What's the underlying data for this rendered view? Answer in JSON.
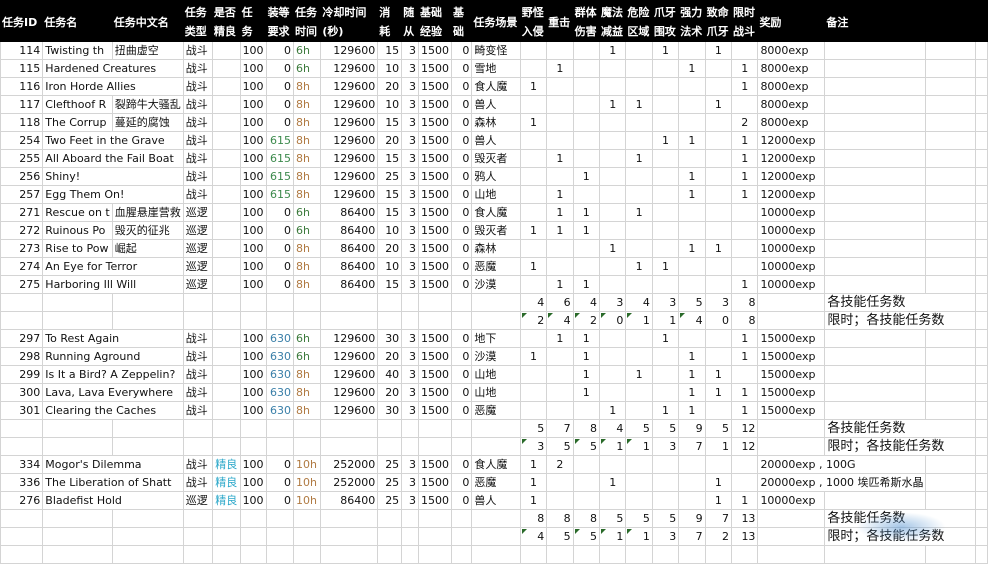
{
  "headers": {
    "row1": [
      "任务ID",
      "任务名",
      "任务中文名",
      "任务",
      "是否",
      "任",
      "装等",
      "任务",
      "冷却时间",
      "消",
      "随",
      "基础",
      "基",
      "任务场景",
      "野怪",
      "重击",
      "群体",
      "魔法",
      "危险",
      "爪牙",
      "强力",
      "致命",
      "限时",
      "奖励",
      "备注"
    ],
    "row2": [
      "",
      "",
      "",
      "类型",
      "精良",
      "务",
      "要求",
      "时间",
      "(秒)",
      "耗",
      "从",
      "经验",
      "础",
      "",
      "入侵",
      "",
      "伤害",
      "减益",
      "区域",
      "围攻",
      "法术",
      "爪牙",
      "战斗",
      "",
      ""
    ]
  },
  "rows": [
    {
      "id": "114",
      "name": "Twisting th",
      "cn": "扭曲虚空",
      "type": "战斗",
      "elite": "",
      "task": "100",
      "gear": "0",
      "time": "6h",
      "cd": "129600",
      "consume": "15",
      "follower": "3",
      "exp": "1500",
      "base": "0",
      "scene": "畸变怪",
      "skills": [
        "",
        "",
        "",
        "1",
        "",
        "1",
        "",
        "1",
        ""
      ],
      "reward": "8000exp"
    },
    {
      "id": "115",
      "name": "Hardened Creatures",
      "cn": "",
      "type": "战斗",
      "elite": "",
      "task": "100",
      "gear": "0",
      "time": "6h",
      "cd": "129600",
      "consume": "10",
      "follower": "3",
      "exp": "1500",
      "base": "0",
      "scene": "雪地",
      "skills": [
        "",
        "1",
        "",
        "",
        "",
        "",
        "1",
        "",
        "1"
      ],
      "reward": "8000exp"
    },
    {
      "id": "116",
      "name": "Iron Horde Allies",
      "cn": "",
      "type": "战斗",
      "elite": "",
      "task": "100",
      "gear": "0",
      "time": "8h",
      "cd": "129600",
      "consume": "20",
      "follower": "3",
      "exp": "1500",
      "base": "0",
      "scene": "食人魔",
      "skills": [
        "1",
        "",
        "",
        "",
        "",
        "",
        "",
        "",
        "1"
      ],
      "reward": "8000exp"
    },
    {
      "id": "117",
      "name": "Clefthoof R",
      "cn": "裂蹄牛大骚乱",
      "type": "战斗",
      "elite": "",
      "task": "100",
      "gear": "0",
      "time": "8h",
      "cd": "129600",
      "consume": "10",
      "follower": "3",
      "exp": "1500",
      "base": "0",
      "scene": "兽人",
      "skills": [
        "",
        "",
        "",
        "1",
        "1",
        "",
        "",
        "1",
        ""
      ],
      "reward": "8000exp"
    },
    {
      "id": "118",
      "name": "The Corrup",
      "cn": "蔓延的腐蚀",
      "type": "战斗",
      "elite": "",
      "task": "100",
      "gear": "0",
      "time": "8h",
      "cd": "129600",
      "consume": "15",
      "follower": "3",
      "exp": "1500",
      "base": "0",
      "scene": "森林",
      "skills": [
        "1",
        "",
        "",
        "",
        "",
        "",
        "",
        "",
        "2"
      ],
      "reward": "8000exp"
    },
    {
      "id": "254",
      "name": "Two Feet in the Grave",
      "cn": "",
      "type": "战斗",
      "elite": "",
      "task": "100",
      "gear": "615",
      "time": "8h",
      "cd": "129600",
      "consume": "20",
      "follower": "3",
      "exp": "1500",
      "base": "0",
      "scene": "兽人",
      "skills": [
        "",
        "",
        "",
        "",
        "",
        "1",
        "1",
        "",
        "1"
      ],
      "reward": "12000exp"
    },
    {
      "id": "255",
      "name": "All Aboard the Fail Boat",
      "cn": "",
      "type": "战斗",
      "elite": "",
      "task": "100",
      "gear": "615",
      "time": "8h",
      "cd": "129600",
      "consume": "15",
      "follower": "3",
      "exp": "1500",
      "base": "0",
      "scene": "毁灭者",
      "skills": [
        "",
        "1",
        "",
        "",
        "1",
        "",
        "",
        "",
        "1"
      ],
      "reward": "12000exp"
    },
    {
      "id": "256",
      "name": "Shiny!",
      "cn": "",
      "type": "战斗",
      "elite": "",
      "task": "100",
      "gear": "615",
      "time": "8h",
      "cd": "129600",
      "consume": "25",
      "follower": "3",
      "exp": "1500",
      "base": "0",
      "scene": "鸦人",
      "skills": [
        "",
        "",
        "1",
        "",
        "",
        "",
        "1",
        "",
        "1"
      ],
      "reward": "12000exp"
    },
    {
      "id": "257",
      "name": "Egg Them On!",
      "cn": "",
      "type": "战斗",
      "elite": "",
      "task": "100",
      "gear": "615",
      "time": "8h",
      "cd": "129600",
      "consume": "15",
      "follower": "3",
      "exp": "1500",
      "base": "0",
      "scene": "山地",
      "skills": [
        "",
        "1",
        "",
        "",
        "",
        "",
        "1",
        "",
        "1"
      ],
      "reward": "12000exp"
    },
    {
      "id": "271",
      "name": "Rescue on t",
      "cn": "血腥悬崖营救",
      "type": "巡逻",
      "elite": "",
      "task": "100",
      "gear": "0",
      "time": "6h",
      "cd": "86400",
      "consume": "15",
      "follower": "3",
      "exp": "1500",
      "base": "0",
      "scene": "食人魔",
      "skills": [
        "",
        "1",
        "1",
        "",
        "1",
        "",
        "",
        "",
        ""
      ],
      "reward": "10000exp"
    },
    {
      "id": "272",
      "name": "Ruinous Po",
      "cn": "毁灭的征兆",
      "type": "巡逻",
      "elite": "",
      "task": "100",
      "gear": "0",
      "time": "6h",
      "cd": "86400",
      "consume": "10",
      "follower": "3",
      "exp": "1500",
      "base": "0",
      "scene": "毁灭者",
      "skills": [
        "1",
        "1",
        "1",
        "",
        "",
        "",
        "",
        "",
        ""
      ],
      "reward": "10000exp"
    },
    {
      "id": "273",
      "name": "Rise to Pow",
      "cn": "崛起",
      "type": "巡逻",
      "elite": "",
      "task": "100",
      "gear": "0",
      "time": "8h",
      "cd": "86400",
      "consume": "20",
      "follower": "3",
      "exp": "1500",
      "base": "0",
      "scene": "森林",
      "skills": [
        "",
        "",
        "",
        "1",
        "",
        "",
        "1",
        "1",
        ""
      ],
      "reward": "10000exp"
    },
    {
      "id": "274",
      "name": "An Eye for Terror",
      "cn": "",
      "type": "巡逻",
      "elite": "",
      "task": "100",
      "gear": "0",
      "time": "8h",
      "cd": "86400",
      "consume": "10",
      "follower": "3",
      "exp": "1500",
      "base": "0",
      "scene": "恶魔",
      "skills": [
        "1",
        "",
        "",
        "",
        "1",
        "1",
        "",
        "",
        ""
      ],
      "reward": "10000exp"
    },
    {
      "id": "275",
      "name": "Harboring Ill Will",
      "cn": "",
      "type": "巡逻",
      "elite": "",
      "task": "100",
      "gear": "0",
      "time": "8h",
      "cd": "86400",
      "consume": "15",
      "follower": "3",
      "exp": "1500",
      "base": "0",
      "scene": "沙漠",
      "skills": [
        "",
        "1",
        "1",
        "",
        "",
        "",
        "",
        "",
        "1"
      ],
      "reward": "10000exp"
    }
  ],
  "summary1": {
    "totals": [
      "4",
      "6",
      "4",
      "3",
      "4",
      "3",
      "5",
      "3",
      "8"
    ],
    "timed": [
      "2",
      "4",
      "2",
      "0",
      "1",
      "1",
      "4",
      "0",
      "8"
    ],
    "label_totals": "各技能任务数",
    "label_timed": "限时；各技能任务数"
  },
  "rows2": [
    {
      "id": "297",
      "name": "To Rest Again",
      "cn": "",
      "type": "战斗",
      "elite": "",
      "task": "100",
      "gear": "630",
      "time": "6h",
      "cd": "129600",
      "consume": "30",
      "follower": "3",
      "exp": "1500",
      "base": "0",
      "scene": "地下",
      "skills": [
        "",
        "1",
        "1",
        "",
        "",
        "1",
        "",
        "",
        "1"
      ],
      "reward": "15000exp"
    },
    {
      "id": "298",
      "name": "Running Aground",
      "cn": "",
      "type": "战斗",
      "elite": "",
      "task": "100",
      "gear": "630",
      "time": "6h",
      "cd": "129600",
      "consume": "20",
      "follower": "3",
      "exp": "1500",
      "base": "0",
      "scene": "沙漠",
      "skills": [
        "1",
        "",
        "1",
        "",
        "",
        "",
        "1",
        "",
        "1"
      ],
      "reward": "15000exp"
    },
    {
      "id": "299",
      "name": "Is It a Bird? A Zeppelin?",
      "cn": "",
      "type": "战斗",
      "elite": "",
      "task": "100",
      "gear": "630",
      "time": "8h",
      "cd": "129600",
      "consume": "40",
      "follower": "3",
      "exp": "1500",
      "base": "0",
      "scene": "山地",
      "skills": [
        "",
        "",
        "1",
        "",
        "1",
        "",
        "1",
        "1",
        ""
      ],
      "reward": "15000exp"
    },
    {
      "id": "300",
      "name": "Lava, Lava Everywhere",
      "cn": "",
      "type": "战斗",
      "elite": "",
      "task": "100",
      "gear": "630",
      "time": "8h",
      "cd": "129600",
      "consume": "20",
      "follower": "3",
      "exp": "1500",
      "base": "0",
      "scene": "山地",
      "skills": [
        "",
        "",
        "1",
        "",
        "",
        "",
        "1",
        "1",
        "1"
      ],
      "reward": "15000exp"
    },
    {
      "id": "301",
      "name": "Clearing the Caches",
      "cn": "",
      "type": "战斗",
      "elite": "",
      "task": "100",
      "gear": "630",
      "time": "8h",
      "cd": "129600",
      "consume": "30",
      "follower": "3",
      "exp": "1500",
      "base": "0",
      "scene": "恶魔",
      "skills": [
        "",
        "",
        "",
        "1",
        "",
        "1",
        "1",
        "",
        "1"
      ],
      "reward": "15000exp"
    }
  ],
  "summary2": {
    "totals": [
      "5",
      "7",
      "8",
      "4",
      "5",
      "5",
      "9",
      "5",
      "12"
    ],
    "timed": [
      "3",
      "5",
      "5",
      "1",
      "1",
      "3",
      "7",
      "1",
      "12"
    ],
    "label_totals": "各技能任务数",
    "label_timed": "限时；各技能任务数"
  },
  "rows3": [
    {
      "id": "334",
      "name": "Mogor's Dilemma",
      "cn": "",
      "type": "战斗",
      "elite": "精良",
      "task": "100",
      "gear": "0",
      "time": "10h",
      "cd": "252000",
      "consume": "25",
      "follower": "3",
      "exp": "1500",
      "base": "0",
      "scene": "食人魔",
      "skills": [
        "1",
        "2",
        "",
        "",
        "",
        "",
        "",
        "",
        ""
      ],
      "reward": "20000exp , 100G"
    },
    {
      "id": "336",
      "name": "The Liberation of Shatt",
      "cn": "",
      "type": "战斗",
      "elite": "精良",
      "task": "100",
      "gear": "0",
      "time": "10h",
      "cd": "252000",
      "consume": "25",
      "follower": "3",
      "exp": "1500",
      "base": "0",
      "scene": "恶魔",
      "skills": [
        "1",
        "",
        "",
        "1",
        "",
        "",
        "",
        "1",
        ""
      ],
      "reward": "20000exp , 1000 埃匹希斯水晶"
    },
    {
      "id": "276",
      "name": "Bladefist Hold",
      "cn": "",
      "type": "巡逻",
      "elite": "精良",
      "task": "100",
      "gear": "0",
      "time": "10h",
      "cd": "86400",
      "consume": "25",
      "follower": "3",
      "exp": "1500",
      "base": "0",
      "scene": "兽人",
      "skills": [
        "1",
        "",
        "",
        "",
        "",
        "",
        "",
        "1",
        "1"
      ],
      "reward": "10000exp"
    }
  ],
  "summary3": {
    "totals": [
      "8",
      "8",
      "8",
      "5",
      "5",
      "5",
      "9",
      "7",
      "13"
    ],
    "timed": [
      "4",
      "5",
      "5",
      "1",
      "1",
      "3",
      "7",
      "2",
      "13"
    ],
    "label_totals": "各技能任务数",
    "label_timed": "限时；各技能任务数"
  },
  "colors": {
    "header_bg": "#000000",
    "time_6h": "#3c7a3c",
    "time_8h": "#b07a42",
    "gear_615": "#3c8a4c",
    "gear_630": "#3a7fa8",
    "elite": "#2aa7c9"
  }
}
